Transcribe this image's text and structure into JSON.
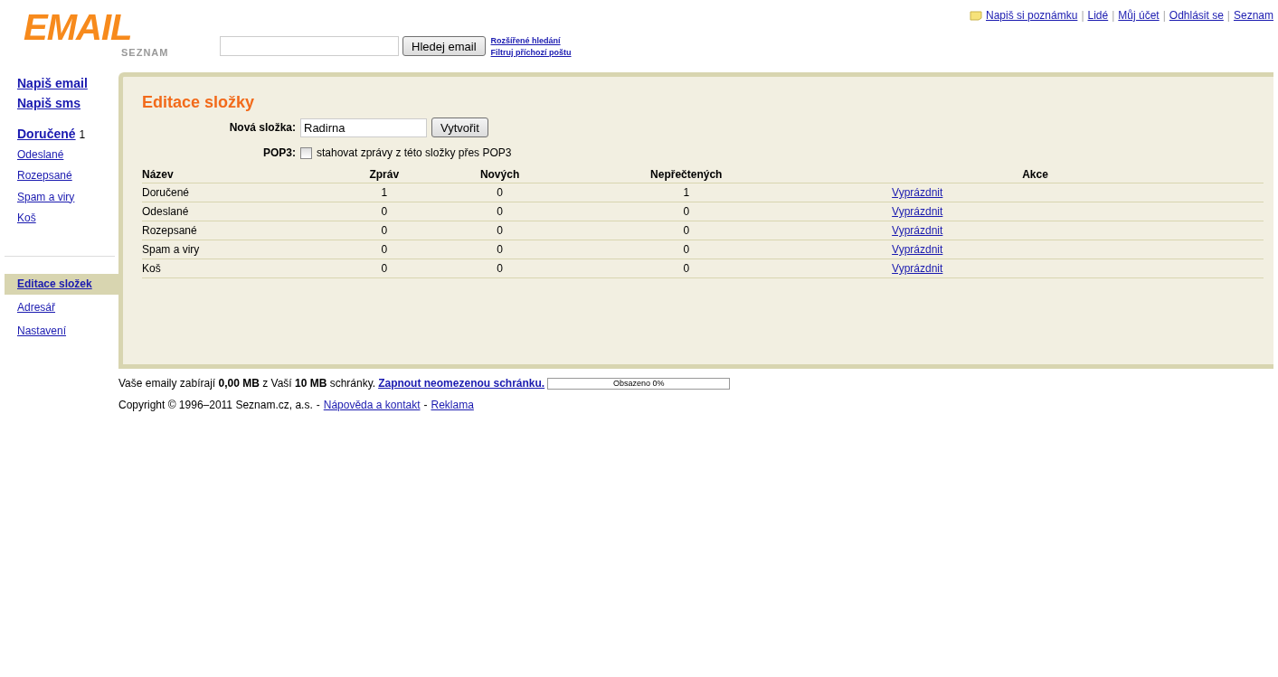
{
  "logo": {
    "title": "EMAIL",
    "subtitle": "SEZNAM"
  },
  "search": {
    "button": "Hledej email",
    "links": [
      "Rozšířené hledání",
      "Filtruj příchozí poštu"
    ]
  },
  "top_links": [
    {
      "kind": "link",
      "text": "Napiš si poznámku"
    },
    {
      "kind": "sep",
      "text": "|"
    },
    {
      "kind": "link",
      "text": "Lidé"
    },
    {
      "kind": "sep",
      "text": "|"
    },
    {
      "kind": "link",
      "text": "Můj účet"
    },
    {
      "kind": "sep",
      "text": "|"
    },
    {
      "kind": "link",
      "text": "Odhlásit se"
    },
    {
      "kind": "sep",
      "text": "|"
    },
    {
      "kind": "link",
      "text": "Seznam"
    }
  ],
  "sidebar": {
    "compose": [
      "Napiš email",
      "Napiš sms"
    ],
    "folders": [
      {
        "label": "Doručené",
        "count": "1",
        "unread": true
      },
      {
        "label": "Odeslané",
        "unread": false
      },
      {
        "label": "Rozepsané",
        "unread": false
      },
      {
        "label": "Spam a viry",
        "unread": false
      },
      {
        "label": "Koš",
        "unread": false
      }
    ],
    "tools": [
      {
        "label": "Editace složek",
        "selected": true
      },
      {
        "label": "Adresář",
        "selected": false
      },
      {
        "label": "Nastavení",
        "selected": false
      }
    ]
  },
  "main": {
    "title": "Editace složky",
    "new_folder": {
      "label": "Nová složka:",
      "value": "Radirna",
      "button": "Vytvořit"
    },
    "pop3": {
      "label": "POP3:",
      "checked": false,
      "text": "stahovat zprávy z této složky přes POP3"
    },
    "table": {
      "columns": [
        "Název",
        "Zpráv",
        "Nových",
        "Nepřečtených",
        "Akce"
      ],
      "rows": [
        {
          "name": "Doručené",
          "messages": "1",
          "new": "0",
          "unread": "1",
          "action": "Vyprázdnit"
        },
        {
          "name": "Odeslané",
          "messages": "0",
          "new": "0",
          "unread": "0",
          "action": "Vyprázdnit"
        },
        {
          "name": "Rozepsané",
          "messages": "0",
          "new": "0",
          "unread": "0",
          "action": "Vyprázdnit"
        },
        {
          "name": "Spam a viry",
          "messages": "0",
          "new": "0",
          "unread": "0",
          "action": "Vyprázdnit"
        },
        {
          "name": "Koš",
          "messages": "0",
          "new": "0",
          "unread": "0",
          "action": "Vyprázdnit"
        }
      ]
    }
  },
  "footer": {
    "usage": "Vaše emaily zabírají **0,00 MB** z Vaší **10 MB** schránky.",
    "upgrade_link": "Zapnout neomezenou schránku.",
    "meter": {
      "label": "Obsazeno 0%",
      "level": 0
    },
    "copyright": [
      {
        "kind": "text",
        "text": "Copyright © 1996–2011 Seznam.cz, a.s."
      },
      {
        "kind": "text",
        "text": "-"
      },
      {
        "kind": "link",
        "text": "Nápověda a kontakt"
      },
      {
        "kind": "text",
        "text": "-"
      },
      {
        "kind": "link",
        "text": "Reklama"
      }
    ]
  }
}
